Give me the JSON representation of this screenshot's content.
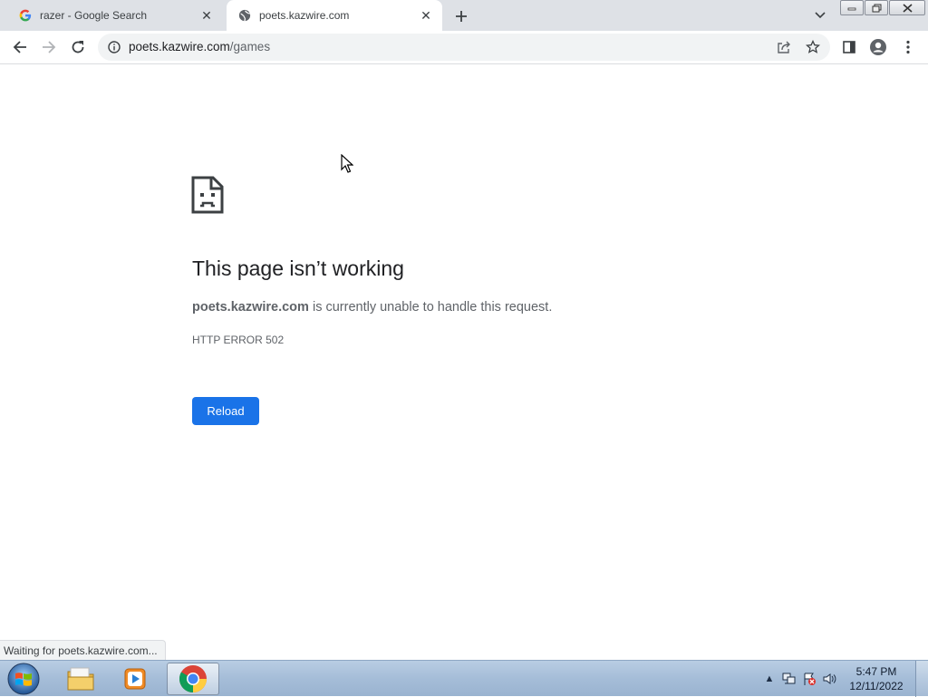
{
  "tabs": [
    {
      "title": "razer - Google Search",
      "favicon": "google-g-icon"
    },
    {
      "title": "poets.kazwire.com",
      "favicon": "globe-icon"
    }
  ],
  "omnibox": {
    "host": "poets.kazwire.com",
    "path": "/games"
  },
  "error": {
    "title": "This page isn’t working",
    "host": "poets.kazwire.com",
    "message": " is currently unable to handle this request.",
    "code": "HTTP ERROR 502",
    "reload_label": "Reload"
  },
  "status": "Waiting for poets.kazwire.com...",
  "taskbar": {
    "time": "5:47 PM",
    "date": "12/11/2022"
  },
  "colors": {
    "accent": "#1a73e8",
    "tabstrip": "#dee1e6"
  }
}
